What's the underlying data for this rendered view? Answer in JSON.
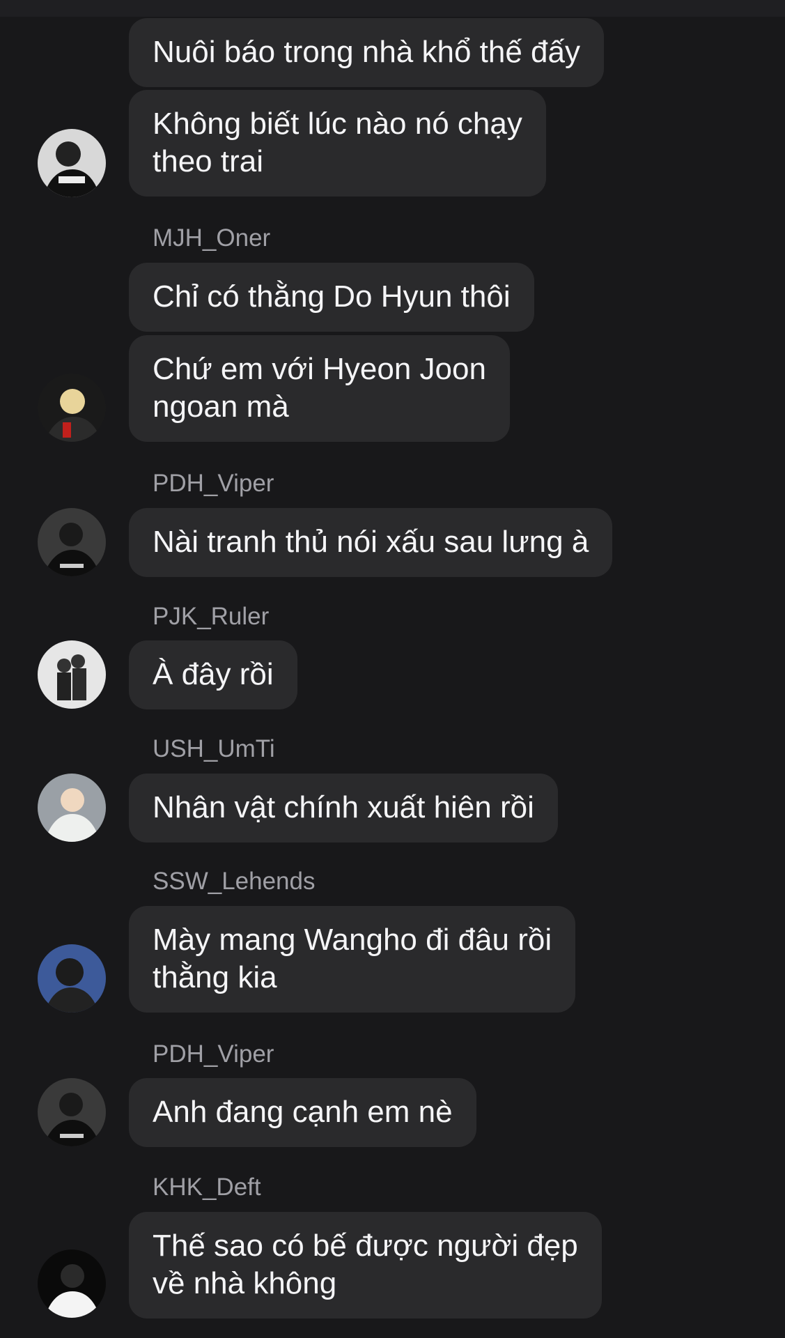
{
  "colors": {
    "background": "#18181a",
    "bubble": "#2a2a2c",
    "text": "#f5f5f7",
    "sender": "#a0a0a6"
  },
  "messages": [
    {
      "text": "Nuôi báo trong nhà khổ thế đấy"
    },
    {
      "text": "Không biết lúc nào nó chạy theo trai",
      "lines": [
        "Không biết lúc nào nó chạy",
        "theo trai"
      ]
    },
    {
      "sender": "MJH_Oner"
    },
    {
      "text": "Chỉ có thằng Do Hyun thôi"
    },
    {
      "lines": [
        "Chứ em với Hyeon Joon",
        "ngoan mà"
      ]
    },
    {
      "sender": "PDH_Viper"
    },
    {
      "text": "Nài tranh thủ nói xấu sau lưng à"
    },
    {
      "sender": "PJK_Ruler"
    },
    {
      "text": "À đây rồi"
    },
    {
      "sender": "USH_UmTi"
    },
    {
      "text": "Nhân vật chính xuất hiên rồi"
    },
    {
      "sender": "SSW_Lehends"
    },
    {
      "lines": [
        "Mày mang Wangho đi đâu rồi",
        "thằng kia"
      ]
    },
    {
      "sender": "PDH_Viper"
    },
    {
      "text": "Anh đang cạnh em nè"
    },
    {
      "sender": "KHK_Deft"
    },
    {
      "lines": [
        "Thế sao có bế được người đẹp",
        "về nhà không"
      ]
    }
  ],
  "chat": {
    "m1": "Nuôi báo trong nhà khổ thế đấy",
    "m2a": "Không biết lúc nào nó chạy",
    "m2b": "theo trai",
    "s_oner": "MJH_Oner",
    "m3": "Chỉ có thằng Do Hyun thôi",
    "m4a": "Chứ em với Hyeon Joon",
    "m4b": "ngoan mà",
    "s_viper1": "PDH_Viper",
    "m5": "Nài tranh thủ nói xấu sau lưng à",
    "s_ruler": "PJK_Ruler",
    "m6": "À đây rồi",
    "s_umti": "USH_UmTi",
    "m7": "Nhân vật chính xuất hiên rồi",
    "s_lehends": "SSW_Lehends",
    "m8a": "Mày mang Wangho đi đâu rồi",
    "m8b": "thằng kia",
    "s_viper2": "PDH_Viper",
    "m9": "Anh đang cạnh em nè",
    "s_deft": "KHK_Deft",
    "m10a": "Thế sao có bế được người đẹp",
    "m10b": "về nhà không"
  },
  "avatars": {
    "a1": "avatar-photo",
    "a2": "avatar-photo",
    "a3": "avatar-photo",
    "a4": "avatar-photo",
    "a5": "avatar-photo",
    "a6": "avatar-photo",
    "a7": "avatar-photo",
    "a8": "avatar-photo"
  }
}
